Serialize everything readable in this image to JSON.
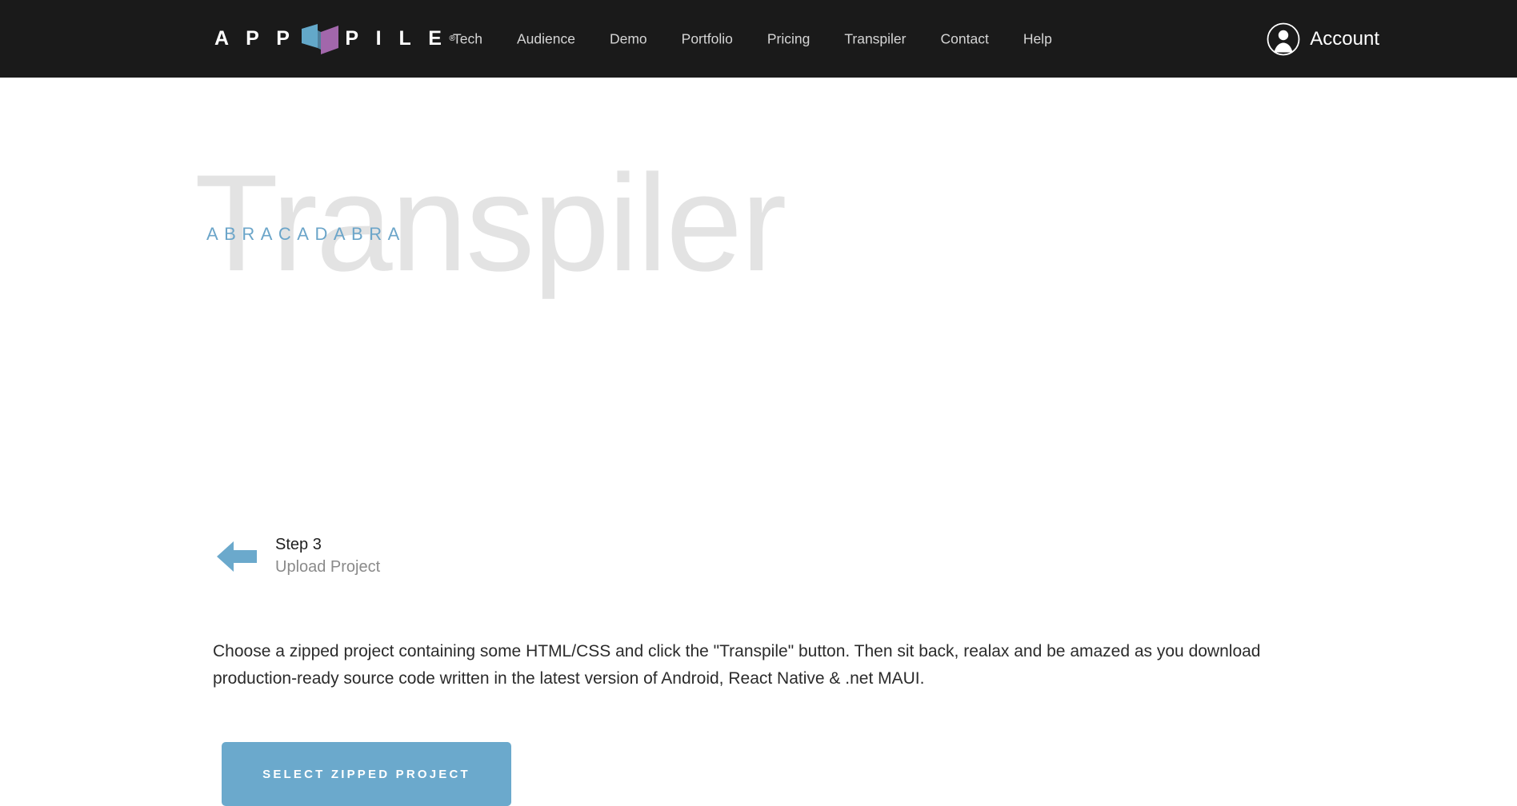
{
  "header": {
    "background_color": "#1a1a1a",
    "logo": {
      "word_left": "A P P",
      "word_right": "P I L E",
      "registered_mark": "®",
      "icon_left_color": "#63a8c9",
      "icon_right_color": "#a267ab",
      "icon_name": "open-book-logo-icon"
    },
    "nav": [
      {
        "label": "Tech"
      },
      {
        "label": "Audience"
      },
      {
        "label": "Demo"
      },
      {
        "label": "Portfolio"
      },
      {
        "label": "Pricing"
      },
      {
        "label": "Transpiler"
      },
      {
        "label": "Contact"
      },
      {
        "label": "Help"
      }
    ],
    "account": {
      "label": "Account",
      "icon": "user-avatar-icon"
    }
  },
  "hero": {
    "watermark_word": "Transpiler",
    "watermark_color": "#e3e3e3",
    "kicker": "ABRACADABRA",
    "kicker_color": "#6ba5c9"
  },
  "step": {
    "back_icon": "back-arrow-icon",
    "back_icon_color": "#6ba9cc",
    "title": "Step 3",
    "subtitle": "Upload Project"
  },
  "description": "Choose a zipped project containing some HTML/CSS and click the \"Transpile\" button. Then sit back, realax and be amazed as you download production-ready source code written in the latest version of Android, React Native & .net MAUI.",
  "cta": {
    "label": "Select Zipped Project",
    "background_color": "#6ba9cc",
    "text_color": "#ffffff"
  }
}
